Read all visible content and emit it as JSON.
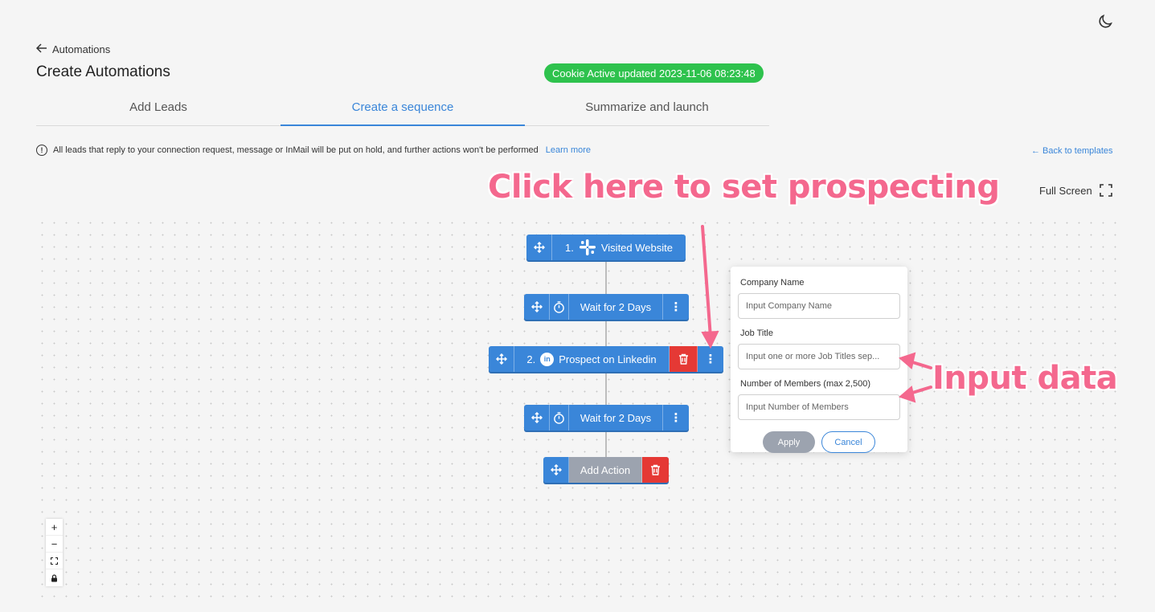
{
  "header": {
    "back_label": "Automations",
    "title": "Create Automations",
    "cookie_status": "Cookie Active updated 2023-11-06 08:23:48"
  },
  "tabs": [
    {
      "label": "Add Leads",
      "active": false
    },
    {
      "label": "Create a sequence",
      "active": true
    },
    {
      "label": "Summarize and launch",
      "active": false
    }
  ],
  "notice": {
    "text": "All leads that reply to your connection request, message or InMail will be put on hold, and further actions won't be performed",
    "link": "Learn more"
  },
  "back_templates": "← Back to templates",
  "fullscreen_label": "Full Screen",
  "annotations": {
    "top": "Click here to set prospecting",
    "right": "Input data"
  },
  "sequence": {
    "step1": {
      "number": "1.",
      "label": "Visited Website"
    },
    "wait1": {
      "label": "Wait for 2 Days"
    },
    "step2": {
      "number": "2.",
      "label": "Prospect on Linkedin"
    },
    "wait2": {
      "label": "Wait for 2 Days"
    },
    "add_action": {
      "label": "Add Action"
    }
  },
  "popup": {
    "company_label": "Company Name",
    "company_placeholder": "Input Company Name",
    "job_label": "Job Title",
    "job_placeholder": "Input one or more Job Titles sep...",
    "members_label": "Number of Members (max 2,500)",
    "members_placeholder": "Input Number of Members",
    "apply": "Apply",
    "cancel": "Cancel"
  },
  "zoom_controls": [
    "+",
    "−",
    "⛶",
    "🔒"
  ],
  "colors": {
    "primary": "#3a86d9",
    "danger": "#e53935",
    "success": "#2ec24d",
    "annotation": "#f4688e",
    "disabled": "#9ca3af"
  },
  "icons": {
    "move": "move-icon",
    "timer": "timer-icon",
    "slack": "slack-icon",
    "linkedin": "linkedin-icon",
    "trash": "trash-icon",
    "more": "more-vertical-icon"
  }
}
